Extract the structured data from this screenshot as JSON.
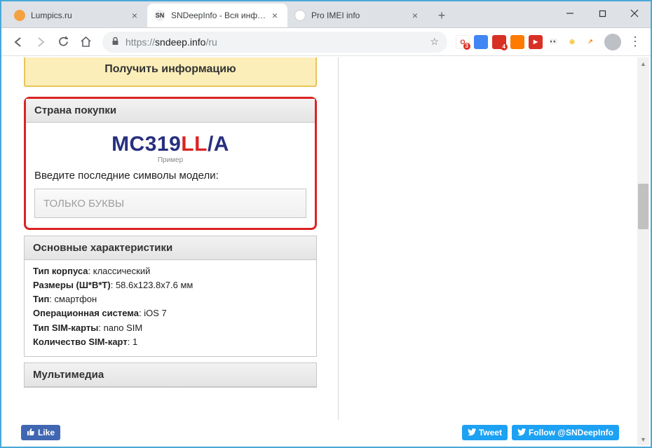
{
  "window": {
    "controls": {
      "min": "minimize",
      "max": "maximize",
      "close": "close"
    }
  },
  "tabs": [
    {
      "title": "Lumpics.ru",
      "active": false,
      "favicon_color": "#f4a142"
    },
    {
      "title": "SNDeepInfo - Вся информа",
      "active": true,
      "favicon_text": "SN"
    },
    {
      "title": "Pro IMEI info",
      "active": false,
      "favicon_text": ""
    }
  ],
  "address": {
    "scheme": "https://",
    "host": "sndeep.info",
    "path": "/ru"
  },
  "extensions": [
    {
      "name": "ext-opera",
      "bg": "#fff",
      "text": "O",
      "fg": "#d93025",
      "badge": "3"
    },
    {
      "name": "ext-translate",
      "bg": "#4285f4",
      "text": ""
    },
    {
      "name": "ext-adblock",
      "bg": "#d93025",
      "text": "",
      "badge": "4"
    },
    {
      "name": "ext-orange",
      "bg": "#ff7b00",
      "text": ""
    },
    {
      "name": "ext-red-play",
      "bg": "#d93025",
      "text": "▶"
    },
    {
      "name": "ext-owl",
      "bg": "#fff",
      "text": "👀"
    },
    {
      "name": "ext-yellow-o",
      "bg": "#f7c948",
      "text": "◉",
      "fg": "#333"
    },
    {
      "name": "ext-swoosh",
      "bg": "#fff",
      "text": "↗",
      "fg": "#ff7b00"
    }
  ],
  "page": {
    "yellow_button": "Получить информацию",
    "country_card": {
      "header": "Страна покупки",
      "model_parts": {
        "a": "MC319",
        "b": "LL",
        "c": "/A"
      },
      "sample_label": "Пример",
      "prompt": "Введите последние символы модели:",
      "placeholder": "ТОЛЬКО БУКВЫ"
    },
    "specs_card": {
      "header": "Основные характеристики",
      "rows": [
        {
          "label": "Тип корпуса",
          "value": "классический"
        },
        {
          "label": "Размеры (Ш*В*Т)",
          "value": "58.6x123.8x7.6 мм"
        },
        {
          "label": "Тип",
          "value": "смартфон"
        },
        {
          "label": "Операционная система",
          "value": "iOS 7"
        },
        {
          "label": "Тип SIM-карты",
          "value": "nano SIM"
        },
        {
          "label": "Количество SIM-карт",
          "value": "1"
        }
      ]
    },
    "multimedia_card": {
      "header": "Мультимедиа"
    }
  },
  "footer": {
    "like": "Like",
    "tweet": "Tweet",
    "follow": "Follow @SNDeepInfo"
  }
}
